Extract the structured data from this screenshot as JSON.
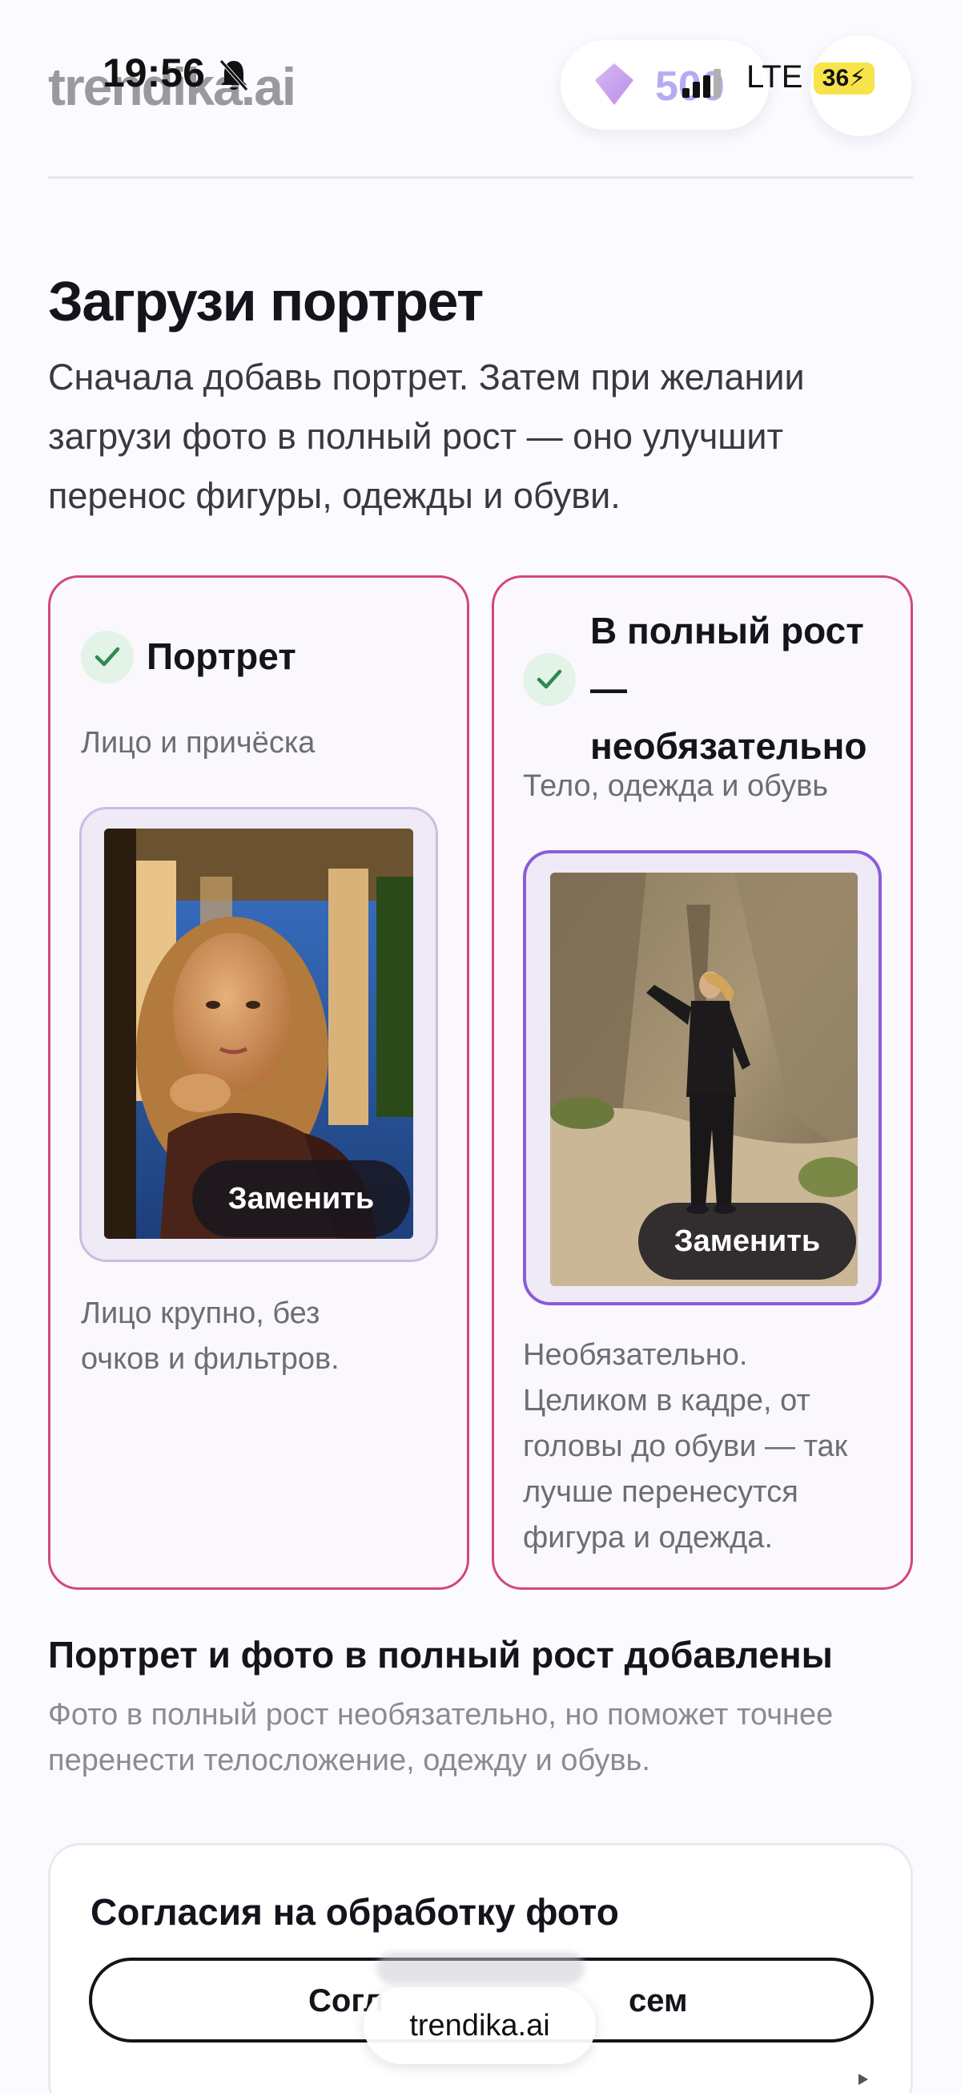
{
  "header": {
    "logo_text": "trendika.ai",
    "credits": "500"
  },
  "status_bar": {
    "time": "19:56",
    "network": "LTE",
    "battery": "36"
  },
  "title": "Загрузи портрет",
  "subtitle": "Сначала добавь портрет. Затем при желании загрузи фото в полный рост — оно улучшит перенос фигуры, одежды и обуви.",
  "cards": [
    {
      "title": "Портрет",
      "description": "Лицо и причёска",
      "replace_label": "Заменить",
      "note": "Лицо крупно, без очков и фильтров."
    },
    {
      "title_lines": [
        "В полный рост",
        "—",
        "необязательно"
      ],
      "description": "Тело, одежда и обувь",
      "replace_label": "Заменить",
      "note": "Необязательно. Целиком в кадре, от головы до обуви — так лучше перенесутся фигура и одежда."
    }
  ],
  "summary": {
    "title": "Портрет и фото в полный рост добавлены",
    "text": "Фото в полный рост необязательно, но поможет точнее перенести телосложение, одежду и обувь."
  },
  "consent": {
    "title": "Согласия на обработку фото",
    "button_left": "Согл",
    "button_right": "сем"
  },
  "browser": {
    "url": "trendika.ai"
  },
  "colors": {
    "accent_border": "#d2477e",
    "selected_frame": "#8a5cd8",
    "check_bg": "#e3f3e8",
    "check_mark": "#2f8a4c",
    "credits_color": "#b9a9f2"
  }
}
